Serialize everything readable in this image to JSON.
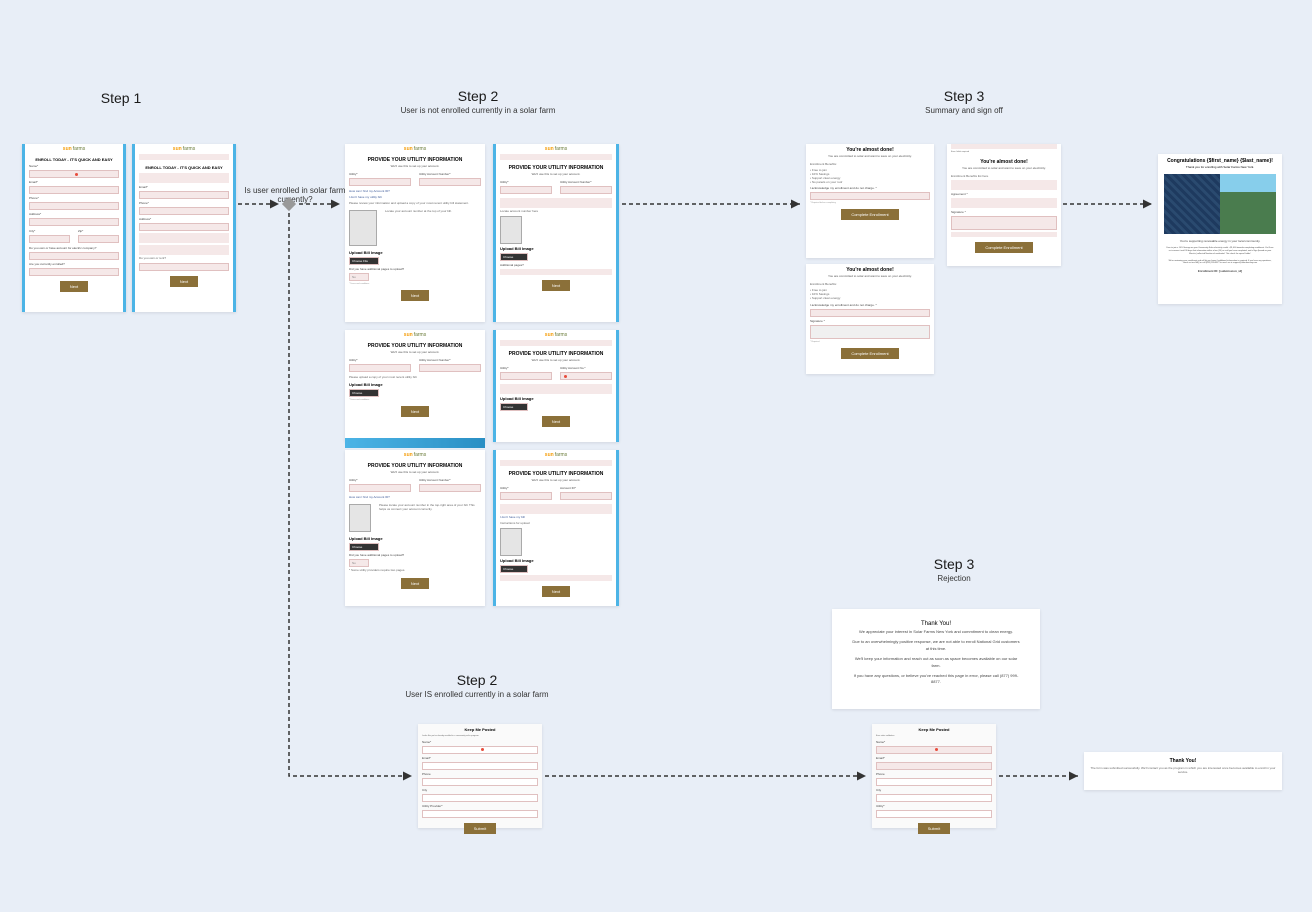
{
  "steps": {
    "s1": {
      "title": "Step 1"
    },
    "s2a": {
      "title": "Step 2",
      "sub": "User is not enrolled currently in a solar farm"
    },
    "s2b": {
      "title": "Step 2",
      "sub": "User IS enrolled currently in a solar farm"
    },
    "s3a": {
      "title": "Step 3",
      "sub": "Summary and sign off"
    },
    "s3b": {
      "title": "Step 3",
      "sub": "Rejection"
    }
  },
  "decision": "Is user enrolled in solar farm currently?",
  "logo": {
    "sun": "sun",
    "farms": "farms"
  },
  "screens": {
    "enroll": {
      "title": "ENROLL TODAY - IT'S QUICK AND EASY",
      "fields": [
        "Name*",
        "Email*",
        "Phone*",
        "Address*",
        "City*",
        "State*",
        "Zip*"
      ],
      "question": "Do you own or have account for electric company?",
      "btn": "Next"
    },
    "enroll2": {
      "title": "ENROLL TODAY - IT'S QUICK AND EASY",
      "btn": "Next"
    },
    "utility": {
      "title": "PROVIDE YOUR UTILITY INFORMATION",
      "sub": "We'll use this to set up your account.",
      "labels": {
        "utility": "Utility*",
        "account": "Utility Account Number*"
      },
      "howFind": "How can I find my",
      "noBill": "I don't have my utility bill.",
      "upload": "Upload Bill Image",
      "extraPages": "Did you have additional pages to upload?",
      "btn": "Next"
    },
    "summary": {
      "title": "You're almost done!",
      "sub": "You are committed to solar and want to save on your electricity.",
      "benefits": "Enrollment Benefits:",
      "ack": "I acknowledge my enrollment and do not charge. *",
      "agree": "I have read, understood and agree to the terms.",
      "sign": "Signature *",
      "btn": "Complete Enrollment"
    },
    "congrats": {
      "title": "Congratulations {$first_name} {$last_name}!",
      "sub": "Thank you for enrolling with Solar Farms New York.",
      "body1": "You're supporting renewable energy in your local community.",
      "body2": "Free to join = 10% Savings on your Community Solar electricity credit + $1,000 towards completing enrollment. You'll see us increase it until 30 days that information within a few (10) or until you have completed, and a Sign (based on your Electric) collected Number of residential. This check the spam Folder!",
      "body3": "We're reviewing your enrollment and will let you know if additional information is required. If you have any questions, check out our FAQ or call (833) 999-8877 to reach us at support@solarfarmsny.com",
      "body4": "Enrollment ID: [submission_id]"
    },
    "rejection": {
      "title": "Thank You!",
      "lines": [
        "We appreciate your interest in Solar Farms New York and commitment to clean energy.",
        "Due to an overwhelmingly positive response, we are not able to enroll National Grid customers at this time.",
        "We'll keep your information and reach out as soon as space becomes available on our solar farm.",
        "If you have any questions, or believe you've reached this page in error, please call (877) 999-8877."
      ]
    },
    "keepPosted": {
      "title": "Keep Me Posted",
      "intro": "Looks like you're already enrolled in a community solar program.",
      "fields": [
        "Name*",
        "Email*",
        "Phone",
        "City",
        "Utility Provider*"
      ],
      "btn": "Submit"
    },
    "thanksFinal": {
      "title": "Thank You!",
      "body": "The form was submitted successfully. We'll contact you as the program in which you are interested once becomes available to enroll in your service."
    }
  }
}
